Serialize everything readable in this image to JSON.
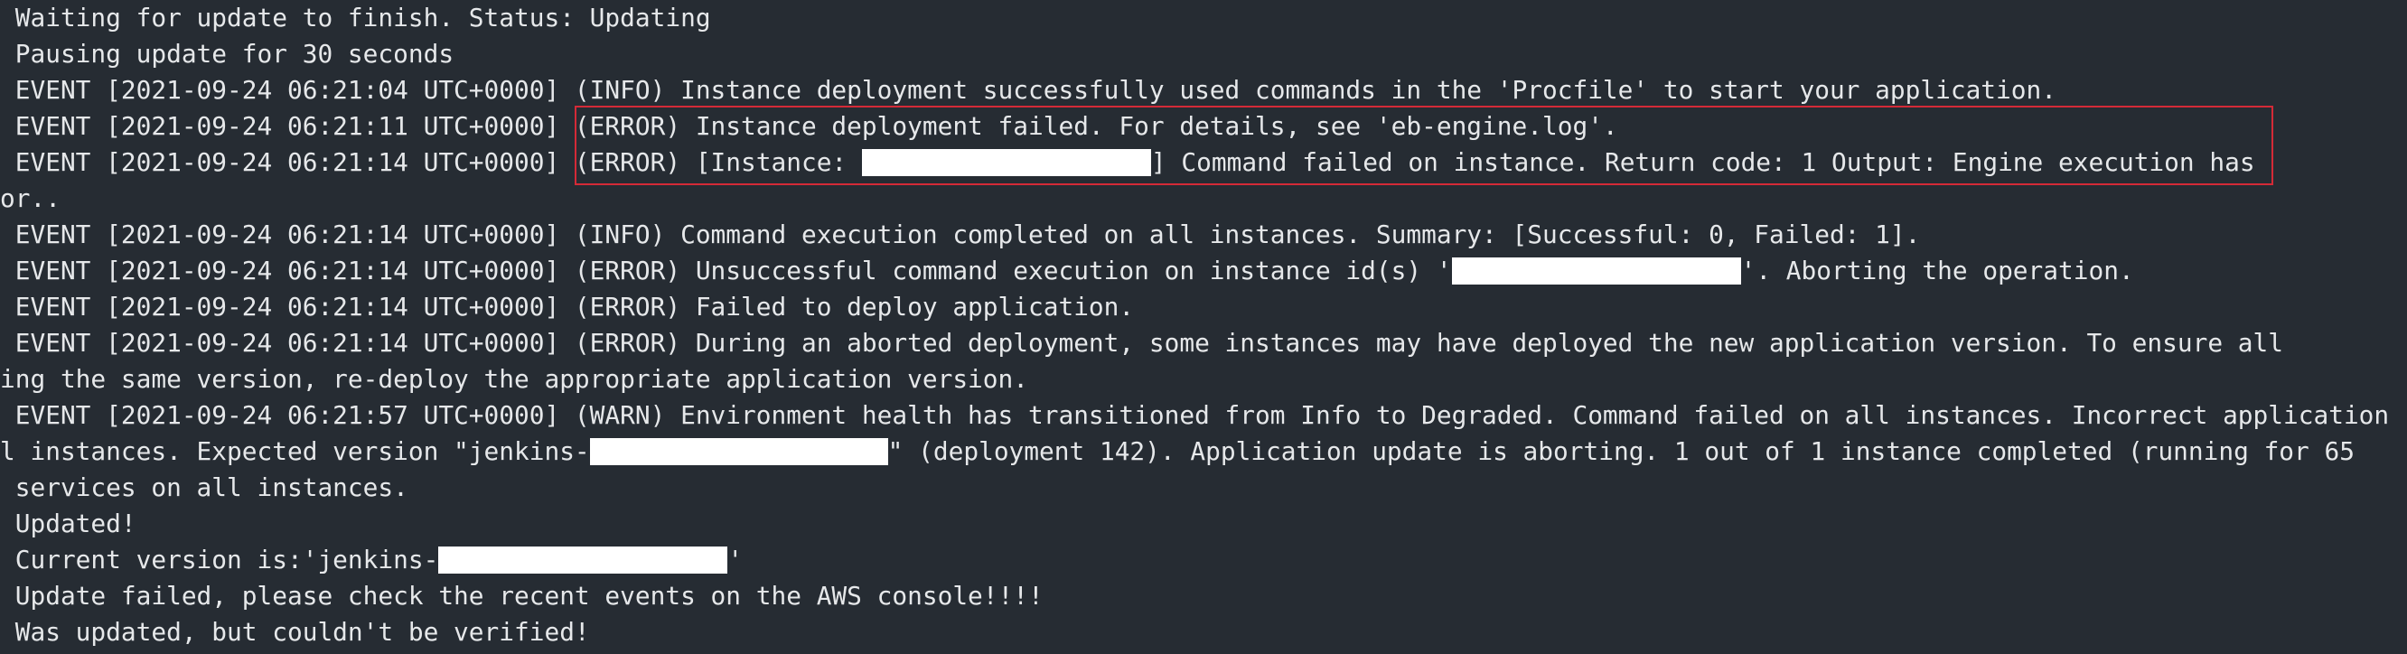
{
  "terminal": {
    "lines": [
      {
        "text": " Waiting for update to finish. Status: Updating"
      },
      {
        "text": " Pausing update for 30 seconds"
      },
      {
        "text": " EVENT [2021-09-24 06:21:04 UTC+0000] (INFO) Instance deployment successfully used commands in the 'Procfile' to start your application."
      },
      {
        "text": " EVENT [2021-09-24 06:21:11 UTC+0000] (ERROR) Instance deployment failed. For details, see 'eb-engine.log'."
      },
      {
        "before": " EVENT [2021-09-24 06:21:14 UTC+0000] (ERROR) [Instance: ",
        "after": "] Command failed on instance. Return code: 1 Output: Engine execution has"
      },
      {
        "text": "or.."
      },
      {
        "text": " EVENT [2021-09-24 06:21:14 UTC+0000] (INFO) Command execution completed on all instances. Summary: [Successful: 0, Failed: 1]."
      },
      {
        "before": " EVENT [2021-09-24 06:21:14 UTC+0000] (ERROR) Unsuccessful command execution on instance id(s) '",
        "after": "'. Aborting the operation."
      },
      {
        "text": " EVENT [2021-09-24 06:21:14 UTC+0000] (ERROR) Failed to deploy application."
      },
      {
        "text": " EVENT [2021-09-24 06:21:14 UTC+0000] (ERROR) During an aborted deployment, some instances may have deployed the new application version. To ensure all"
      },
      {
        "text": "ing the same version, re-deploy the appropriate application version."
      },
      {
        "text": " EVENT [2021-09-24 06:21:57 UTC+0000] (WARN) Environment health has transitioned from Info to Degraded. Command failed on all instances. Incorrect application"
      },
      {
        "before": "l instances. Expected version \"jenkins-",
        "after": "\" (deployment 142). Application update is aborting. 1 out of 1 instance completed (running for 65"
      },
      {
        "text": " services on all instances."
      },
      {
        "text": " Updated!"
      },
      {
        "before": " Current version is:'jenkins-",
        "after": "'"
      },
      {
        "text": " Update failed, please check the recent events on the AWS console!!!!"
      },
      {
        "text": " Was updated, but couldn't be verified!"
      }
    ]
  },
  "colors": {
    "background": "#262c33",
    "text": "#e6e8ea",
    "highlight_border": "#d42a37",
    "redaction": "#ffffff"
  }
}
